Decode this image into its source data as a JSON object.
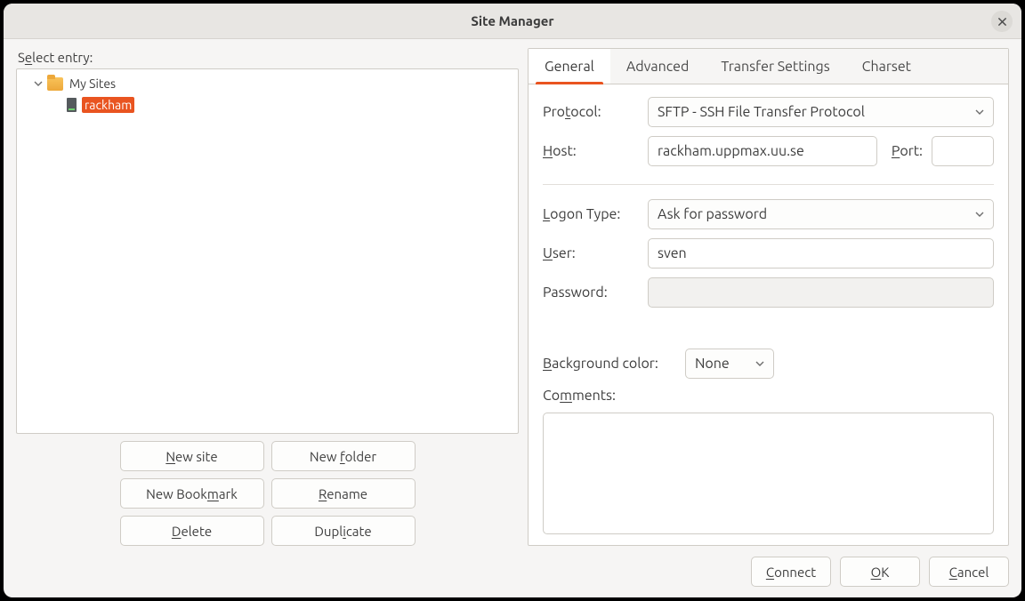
{
  "window": {
    "title": "Site Manager"
  },
  "left": {
    "select_label_pre": "S",
    "select_label_u": "e",
    "select_label_post": "lect entry:",
    "tree": {
      "root_label": "My Sites",
      "site_label": "rackham"
    },
    "buttons": {
      "new_site_pre": "",
      "new_site_u": "N",
      "new_site_post": "ew site",
      "new_folder_pre": "New ",
      "new_folder_u": "f",
      "new_folder_post": "older",
      "new_bookmark_pre": "New Book",
      "new_bookmark_u": "m",
      "new_bookmark_post": "ark",
      "rename_pre": "",
      "rename_u": "R",
      "rename_post": "ename",
      "delete_pre": "",
      "delete_u": "D",
      "delete_post": "elete",
      "duplicate_pre": "Dupl",
      "duplicate_u": "i",
      "duplicate_post": "cate"
    }
  },
  "tabs": {
    "general": "General",
    "advanced": "Advanced",
    "transfer": "Transfer Settings",
    "charset": "Charset"
  },
  "form": {
    "protocol_label_pre": "Pro",
    "protocol_label_u": "t",
    "protocol_label_post": "ocol:",
    "protocol_value": "SFTP - SSH File Transfer Protocol",
    "host_label_u": "H",
    "host_label_post": "ost:",
    "host_value": "rackham.uppmax.uu.se",
    "port_label_u": "P",
    "port_label_post": "ort:",
    "port_value": "",
    "logon_label_u": "L",
    "logon_label_post": "ogon Type:",
    "logon_value": "Ask for password",
    "user_label_u": "U",
    "user_label_post": "ser:",
    "user_value": "sven",
    "password_label": "Password:",
    "password_value": "",
    "bgcolor_label_u": "B",
    "bgcolor_label_post": "ackground color:",
    "bgcolor_value": "None",
    "comments_label_pre": "Co",
    "comments_label_u": "m",
    "comments_label_post": "ments:",
    "comments_value": ""
  },
  "footer": {
    "connect_u": "C",
    "connect_post": "onnect",
    "ok_u": "O",
    "ok_post": "K",
    "cancel_u": "C",
    "cancel_post": "ancel"
  }
}
